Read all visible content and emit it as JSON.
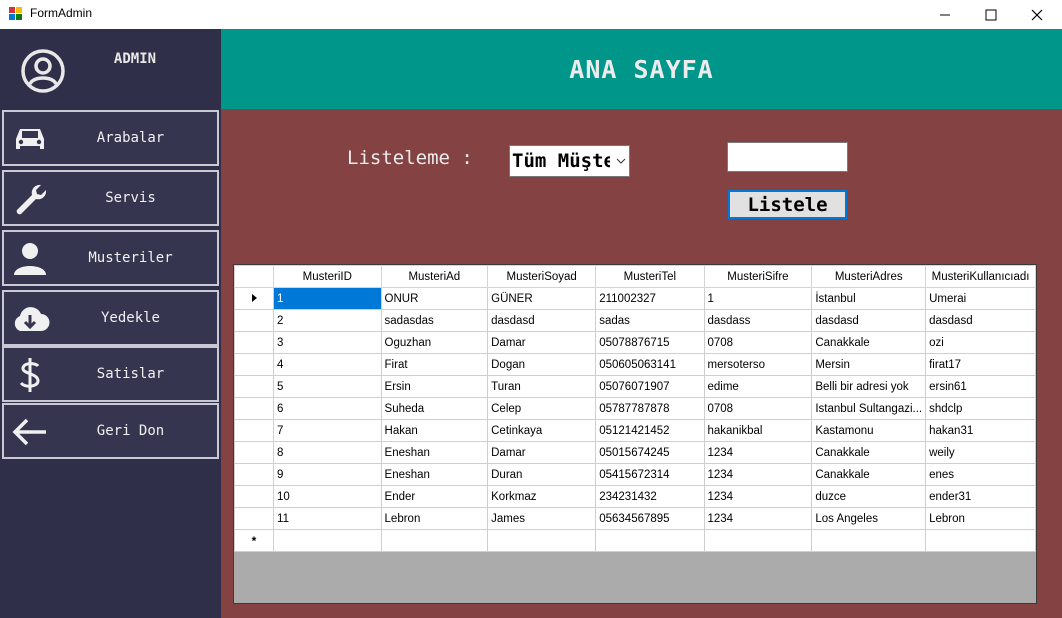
{
  "window": {
    "title": "FormAdmin"
  },
  "sidebar": {
    "user_label": "ADMIN",
    "items": [
      {
        "label": "Arabalar",
        "icon": "car-icon"
      },
      {
        "label": "Servis",
        "icon": "wrench-icon"
      },
      {
        "label": "Musteriler",
        "icon": "person-icon"
      },
      {
        "label": "Yedekle",
        "icon": "cloud-download-icon"
      },
      {
        "label": "Satislar",
        "icon": "dollar-icon"
      },
      {
        "label": "Geri Don",
        "icon": "arrow-left-icon"
      }
    ]
  },
  "header": {
    "title": "ANA SAYFA"
  },
  "filter": {
    "label": "Listeleme :",
    "selected": "Tüm Müşteriler",
    "search_value": "",
    "button_label": "Listele"
  },
  "grid": {
    "columns": [
      "MusteriID",
      "MusteriAd",
      "MusteriSoyad",
      "MusteriTel",
      "MusteriSifre",
      "MusteriAdres",
      "MusteriKullanıcıadı"
    ],
    "rows": [
      [
        "1",
        "ONUR",
        "GÜNER",
        "211002327",
        "1",
        "İstanbul",
        "Umerai"
      ],
      [
        "2",
        "sadasdas",
        "dasdasd",
        "sadas",
        "dasdass",
        "dasdasd",
        "dasdasd"
      ],
      [
        "3",
        "Oguzhan",
        "Damar",
        "05078876715",
        "0708",
        "Canakkale",
        "ozi"
      ],
      [
        "4",
        "Firat",
        "Dogan",
        "050605063141",
        "mersoterso",
        "Mersin",
        "firat17"
      ],
      [
        "5",
        "Ersin",
        "Turan",
        "05076071907",
        "edime",
        "Belli bir adresi yok",
        "ersin61"
      ],
      [
        "6",
        "Suheda",
        "Celep",
        "05787787878",
        "0708",
        "Istanbul Sultangazi...",
        "shdclp"
      ],
      [
        "7",
        "Hakan",
        "Cetinkaya",
        "05121421452",
        "hakanikbal",
        "Kastamonu",
        "hakan31"
      ],
      [
        "8",
        "Eneshan",
        "Damar",
        "05015674245",
        "1234",
        "Canakkale",
        "weily"
      ],
      [
        "9",
        "Eneshan",
        "Duran",
        "05415672314",
        "1234",
        "Canakkale",
        "enes"
      ],
      [
        "10",
        "Ender",
        "Korkmaz",
        "234231432",
        "1234",
        "duzce",
        "ender31"
      ],
      [
        "11",
        "Lebron",
        "James",
        "05634567895",
        "1234",
        "Los Angeles",
        "Lebron"
      ]
    ],
    "new_row_marker": "*"
  },
  "colors": {
    "sidebar_bg": "#2f2f4a",
    "header_bg": "#00968a",
    "main_bg": "#854243",
    "selection": "#0078d7"
  }
}
